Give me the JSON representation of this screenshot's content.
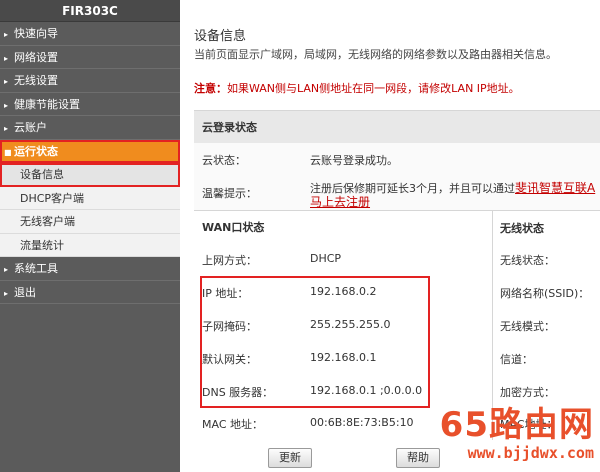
{
  "brand": "FIR303C",
  "sidebar": {
    "items": [
      {
        "label": "快速向导"
      },
      {
        "label": "网络设置"
      },
      {
        "label": "无线设置"
      },
      {
        "label": "健康节能设置"
      },
      {
        "label": "云账户"
      },
      {
        "label": "运行状态"
      },
      {
        "label": "设备信息"
      },
      {
        "label": "DHCP客户端"
      },
      {
        "label": "无线客户端"
      },
      {
        "label": "流量统计"
      },
      {
        "label": "系统工具"
      },
      {
        "label": "退出"
      }
    ]
  },
  "page": {
    "title": "设备信息",
    "desc": "当前页面显示广域网，局域网，无线网络的网络参数以及路由器相关信息。",
    "note_label": "注意：",
    "note_text": "如果WAN侧与LAN侧地址在同一网段，请修改LAN IP地址。"
  },
  "cloud": {
    "header": "云登录状态",
    "status_label": "云状态：",
    "status_value": "云账号登录成功。",
    "tip_label": "温馨提示：",
    "tip_text": "注册后保修期可延长3个月，并且可以通过",
    "tip_link1": "斐讯智慧互联A",
    "tip_link2": "马上去注册"
  },
  "wan": {
    "header": "WAN口状态",
    "rows": [
      {
        "label": "上网方式：",
        "value": "DHCP"
      },
      {
        "label": "IP 地址：",
        "value": "192.168.0.2"
      },
      {
        "label": "子网掩码：",
        "value": "255.255.255.0"
      },
      {
        "label": "默认网关：",
        "value": "192.168.0.1"
      },
      {
        "label": "DNS 服务器：",
        "value": "192.168.0.1 ;0.0.0.0"
      },
      {
        "label": "MAC 地址：",
        "value": "00:6B:8E:73:B5:10"
      }
    ]
  },
  "wireless": {
    "header": "无线状态",
    "rows": [
      {
        "label": "无线状态："
      },
      {
        "label": "网络名称(SSID)："
      },
      {
        "label": "无线模式："
      },
      {
        "label": "信道："
      },
      {
        "label": "加密方式："
      },
      {
        "label": "MAC地址："
      }
    ]
  },
  "buttons": {
    "refresh": "更新",
    "help": "帮助"
  },
  "watermark": {
    "big": "65路由网",
    "small": "www.bjjdwx.com"
  }
}
